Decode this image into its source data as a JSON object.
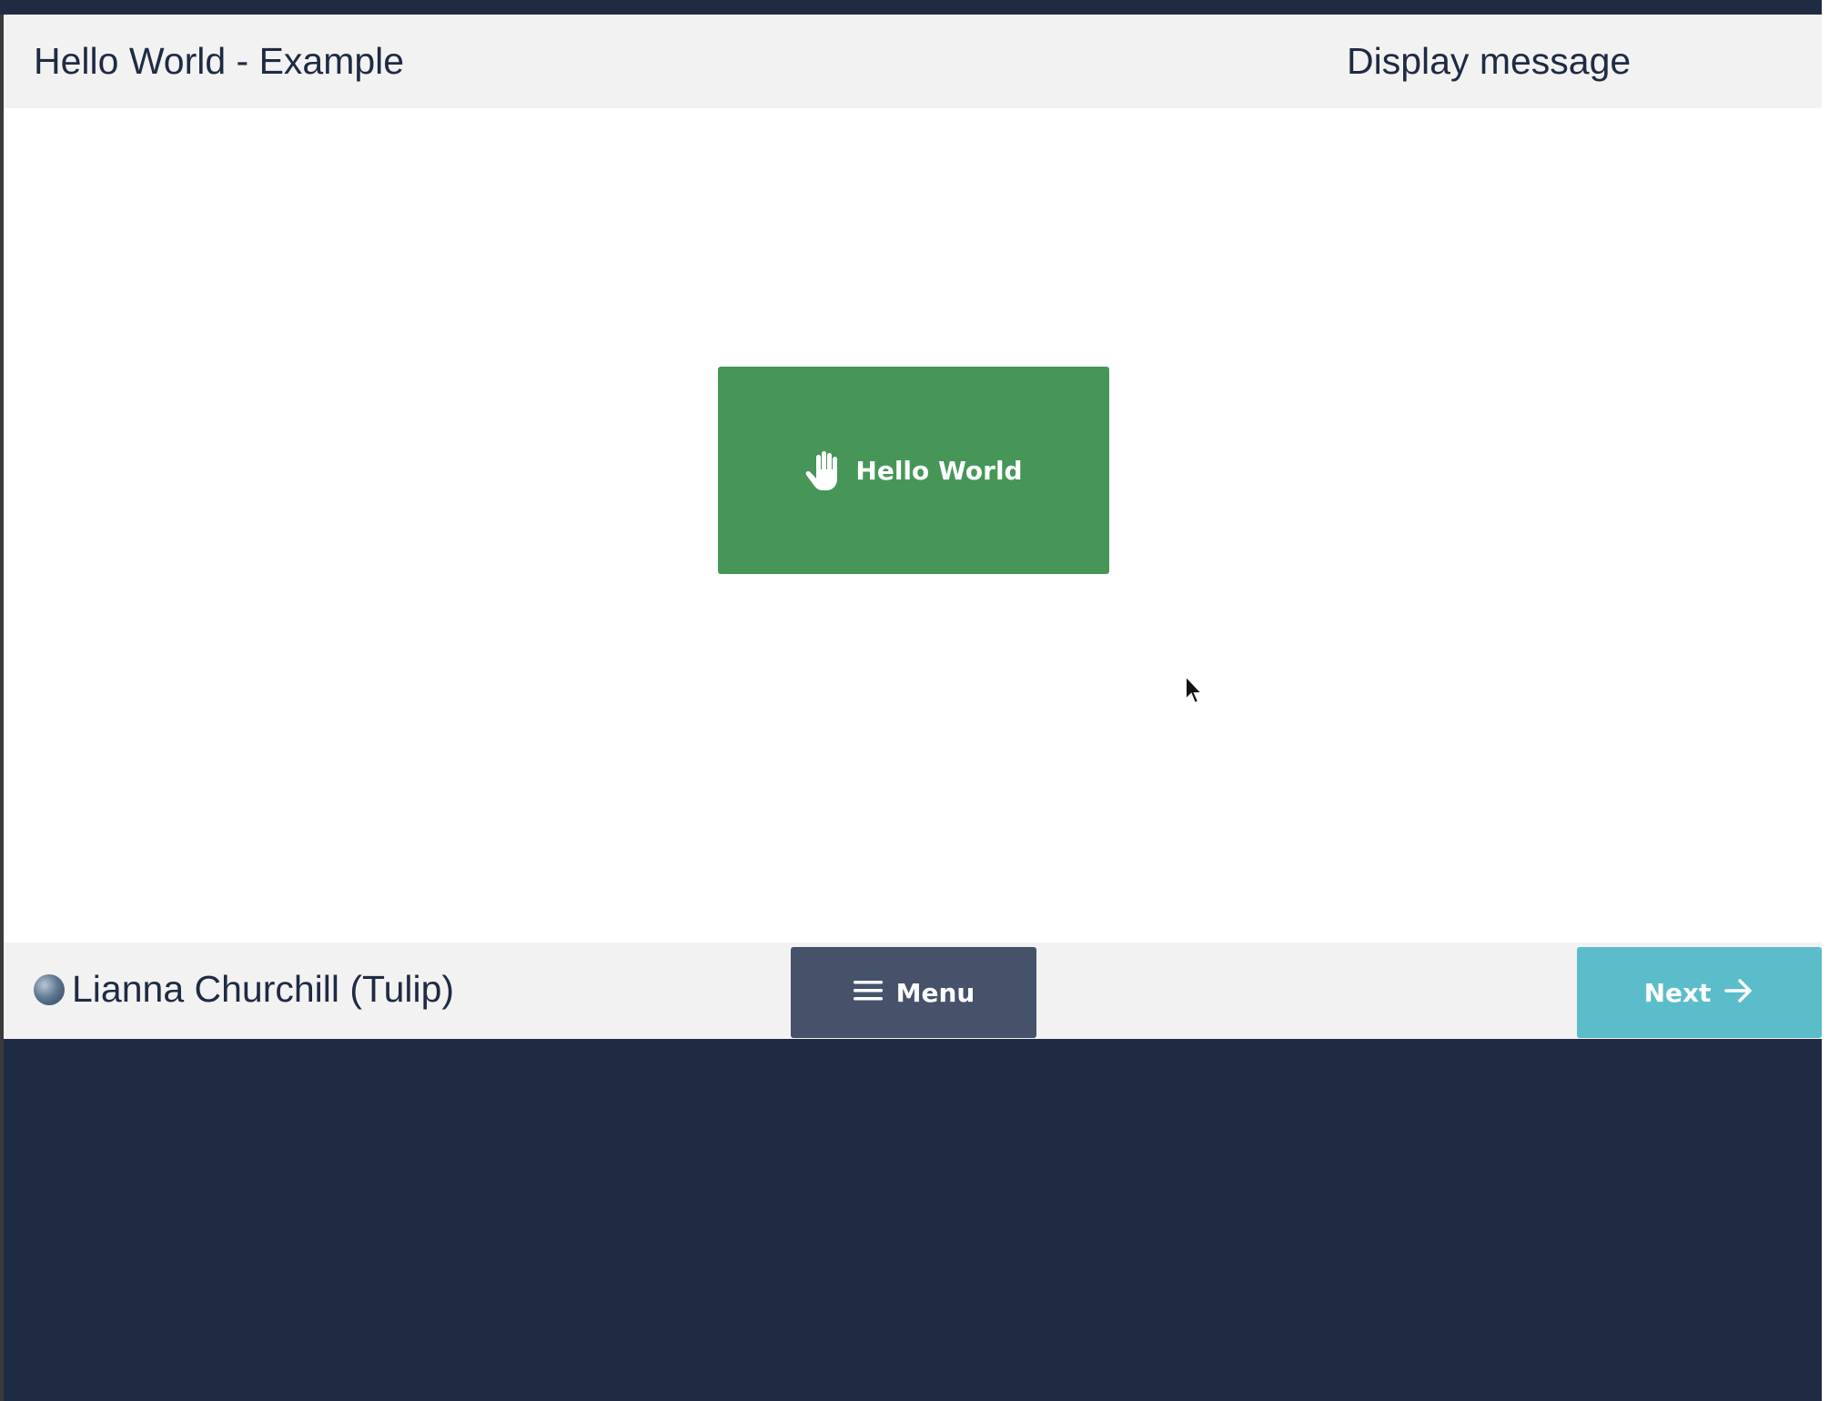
{
  "header": {
    "app_title": "Hello World - Example",
    "step_title": "Display message"
  },
  "canvas": {
    "hello_button_label": "Hello World",
    "hello_button_icon": "hand-icon",
    "hello_button_color": "#469658"
  },
  "footer": {
    "user_name": "Lianna Churchill (Tulip)",
    "menu_label": "Menu",
    "menu_icon": "hamburger-icon",
    "next_label": "Next",
    "next_icon": "arrow-right-icon"
  },
  "colors": {
    "background": "#1f2b43",
    "bar": "#f2f2f2",
    "menu_button": "#45526a",
    "next_button": "#5bbcca",
    "text": "#1f2b43"
  }
}
